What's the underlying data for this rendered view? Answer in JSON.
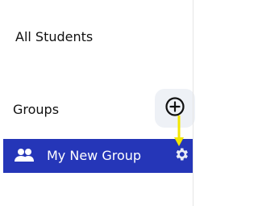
{
  "sidebar": {
    "all_students_label": "All Students",
    "groups_title": "Groups",
    "add_group_icon": "plus-circle-icon",
    "selected_group": {
      "label": "My New Group",
      "icon": "people-icon",
      "settings_icon": "gear-icon"
    }
  },
  "colors": {
    "selected_row": "#2536b8",
    "add_button_bg": "#eef1f6",
    "annotation_arrow": "#f2e600"
  }
}
